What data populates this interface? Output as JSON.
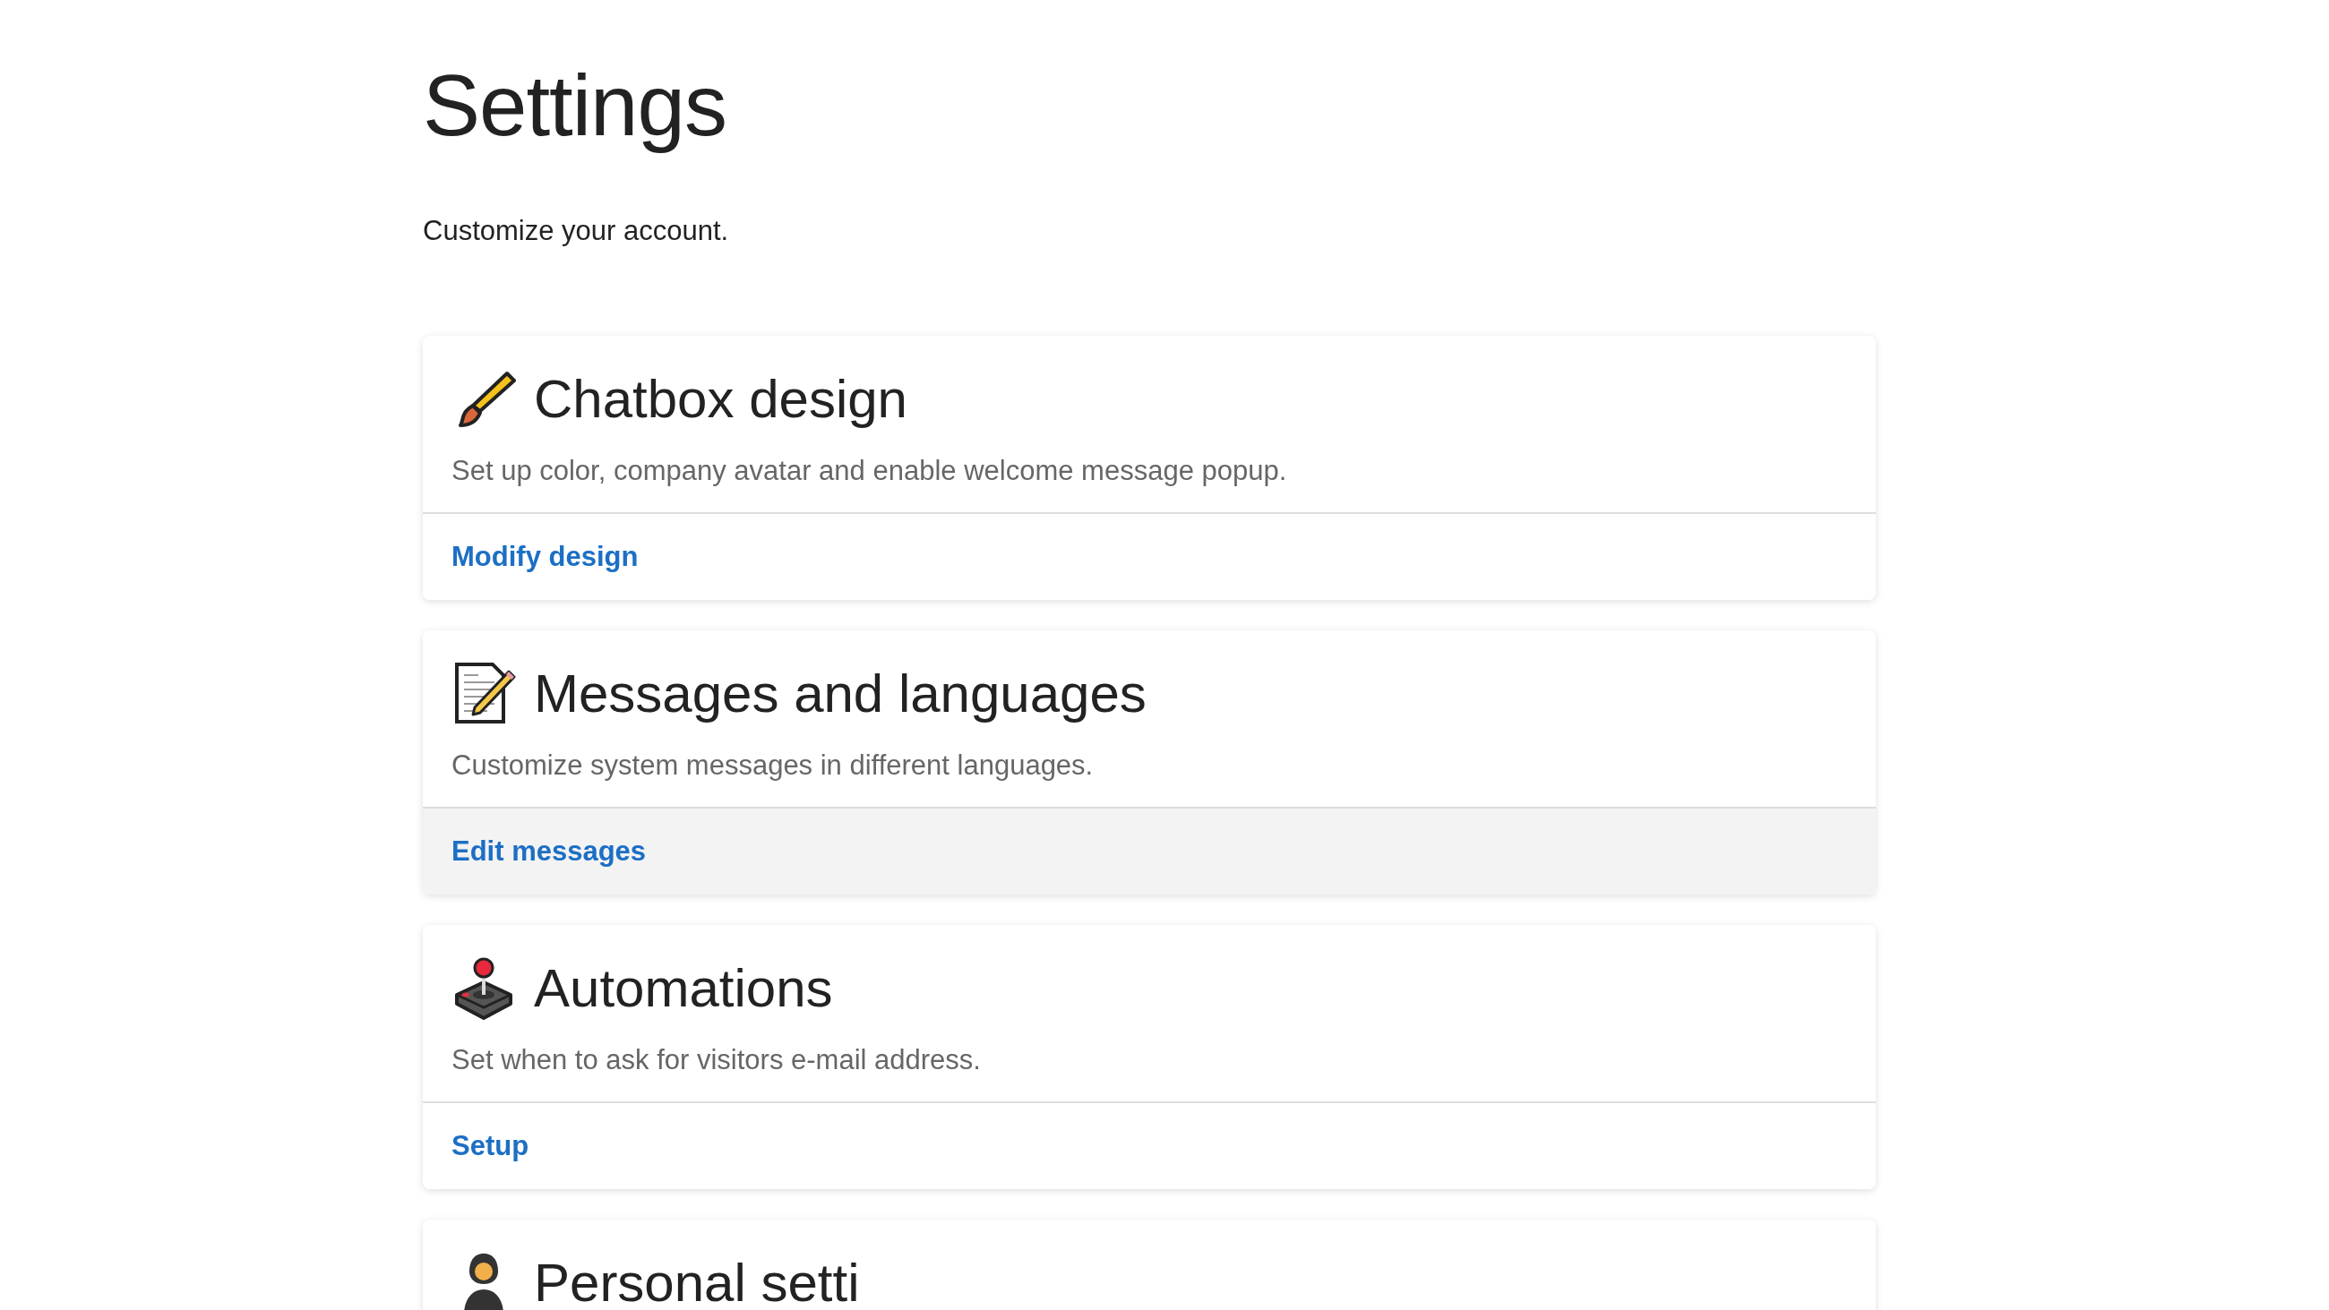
{
  "page": {
    "title": "Settings",
    "subtitle": "Customize your account."
  },
  "cards": [
    {
      "kind": "brush",
      "title": "Chatbox design",
      "description": "Set up color, company avatar and enable welcome message popup.",
      "link": "Modify design",
      "highlighted": false
    },
    {
      "kind": "memo",
      "title": "Messages and languages",
      "description": "Customize system messages in different languages.",
      "link": "Edit messages",
      "highlighted": true
    },
    {
      "kind": "joystick",
      "title": "Automations",
      "description": "Set when to ask for visitors e-mail address.",
      "link": "Setup",
      "highlighted": false
    },
    {
      "kind": "person",
      "title": "Personal setti"
    }
  ]
}
